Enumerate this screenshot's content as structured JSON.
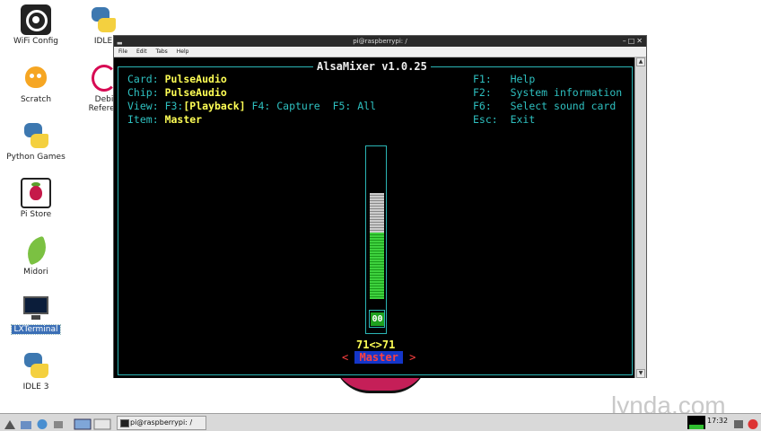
{
  "desktop": {
    "icons": [
      {
        "label": "WiFi Config",
        "icon": "wifi-icon"
      },
      {
        "label": "Scratch",
        "icon": "scratch-icon"
      },
      {
        "label": "Python Games",
        "icon": "python-icon"
      },
      {
        "label": "Pi Store",
        "icon": "pi-store-icon"
      },
      {
        "label": "Midori",
        "icon": "midori-icon"
      },
      {
        "label": "LXTerminal",
        "icon": "terminal-icon"
      },
      {
        "label": "IDLE 3",
        "icon": "python-icon"
      },
      {
        "label": "IDLE",
        "icon": "python-icon"
      },
      {
        "label": "Debi",
        "icon": "debian-icon"
      },
      {
        "label": "Referen",
        "icon": "debian-icon"
      }
    ]
  },
  "window": {
    "title": "pi@raspberrypi: /",
    "menu": [
      "File",
      "Edit",
      "Tabs",
      "Help"
    ]
  },
  "alsamixer": {
    "title": "AlsaMixer v1.0.25",
    "card_label": "Card:",
    "card_value": "PulseAudio",
    "chip_label": "Chip:",
    "chip_value": "PulseAudio",
    "view_label": "View:",
    "view_f3": "F3:",
    "view_playback": "[Playback]",
    "view_f4": "F4: Capture",
    "view_f5": "F5: All",
    "item_label": "Item:",
    "item_value": "Master",
    "help": [
      {
        "key": "F1:",
        "text": "Help"
      },
      {
        "key": "F2:",
        "text": "System information"
      },
      {
        "key": "F6:",
        "text": "Select sound card"
      },
      {
        "key": "Esc:",
        "text": "Exit"
      }
    ],
    "mute_value": "00",
    "volume_text": "71<>71",
    "volume_percent": 71,
    "control_left": "<",
    "control_name": "Master",
    "control_right": ">"
  },
  "taskbar": {
    "task_button": "pi@raspberrypi: /",
    "clock": "17:32"
  },
  "watermark": "lynda.com"
}
